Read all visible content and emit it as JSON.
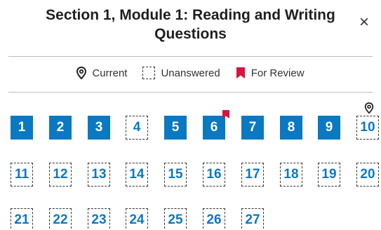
{
  "header": {
    "title_line1": "Section 1, Module 1: Reading and Writing",
    "title_line2": "Questions",
    "close_glyph": "×"
  },
  "legend": {
    "current_label": "Current",
    "unanswered_label": "Unanswered",
    "review_label": "For Review"
  },
  "colors": {
    "accent": "#0b78c2",
    "review_flag": "#d9143f"
  },
  "questions": [
    {
      "n": "1",
      "answered": true,
      "review": false,
      "current": false
    },
    {
      "n": "2",
      "answered": true,
      "review": false,
      "current": false
    },
    {
      "n": "3",
      "answered": true,
      "review": false,
      "current": false
    },
    {
      "n": "4",
      "answered": false,
      "review": false,
      "current": false
    },
    {
      "n": "5",
      "answered": true,
      "review": false,
      "current": false
    },
    {
      "n": "6",
      "answered": true,
      "review": true,
      "current": false
    },
    {
      "n": "7",
      "answered": true,
      "review": false,
      "current": false
    },
    {
      "n": "8",
      "answered": true,
      "review": false,
      "current": false
    },
    {
      "n": "9",
      "answered": true,
      "review": false,
      "current": false
    },
    {
      "n": "10",
      "answered": false,
      "review": false,
      "current": true
    },
    {
      "n": "11",
      "answered": false,
      "review": false,
      "current": false
    },
    {
      "n": "12",
      "answered": false,
      "review": false,
      "current": false
    },
    {
      "n": "13",
      "answered": false,
      "review": false,
      "current": false
    },
    {
      "n": "14",
      "answered": false,
      "review": false,
      "current": false
    },
    {
      "n": "15",
      "answered": false,
      "review": false,
      "current": false
    },
    {
      "n": "16",
      "answered": false,
      "review": false,
      "current": false
    },
    {
      "n": "17",
      "answered": false,
      "review": false,
      "current": false
    },
    {
      "n": "18",
      "answered": false,
      "review": false,
      "current": false
    },
    {
      "n": "19",
      "answered": false,
      "review": false,
      "current": false
    },
    {
      "n": "20",
      "answered": false,
      "review": false,
      "current": false
    },
    {
      "n": "21",
      "answered": false,
      "review": false,
      "current": false
    },
    {
      "n": "22",
      "answered": false,
      "review": false,
      "current": false
    },
    {
      "n": "23",
      "answered": false,
      "review": false,
      "current": false
    },
    {
      "n": "24",
      "answered": false,
      "review": false,
      "current": false
    },
    {
      "n": "25",
      "answered": false,
      "review": false,
      "current": false
    },
    {
      "n": "26",
      "answered": false,
      "review": false,
      "current": false
    },
    {
      "n": "27",
      "answered": false,
      "review": false,
      "current": false
    }
  ]
}
